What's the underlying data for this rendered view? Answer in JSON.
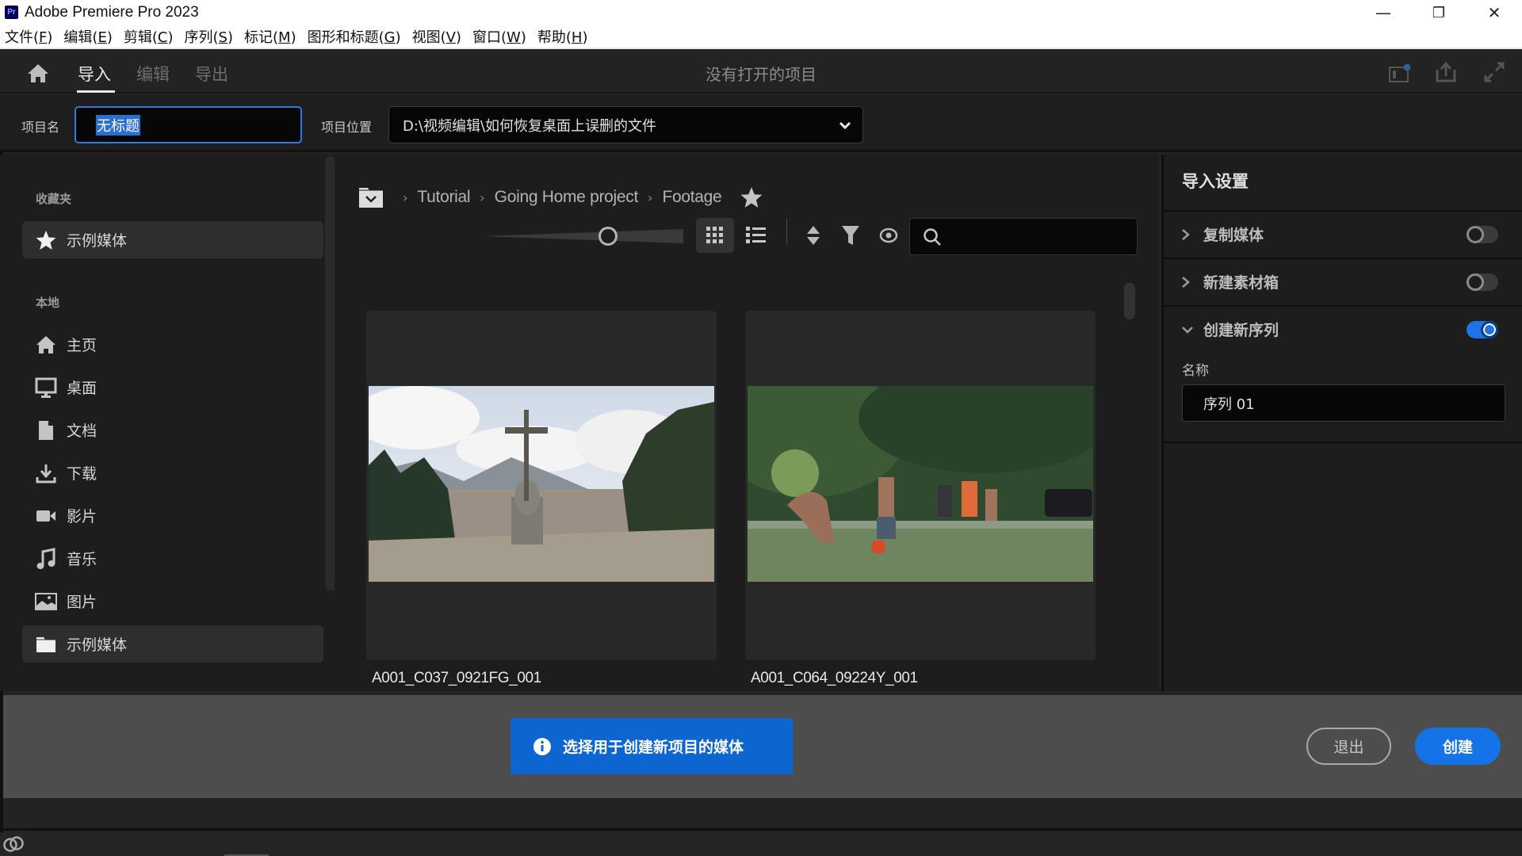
{
  "window": {
    "app_badge": "Pr",
    "title": "Adobe Premiere Pro 2023",
    "controls": {
      "minimize": "—",
      "restore": "❐",
      "close": "✕"
    }
  },
  "menu": [
    {
      "label": "文件(",
      "key": "F",
      "end": ")"
    },
    {
      "label": "编辑(",
      "key": "E",
      "end": ")"
    },
    {
      "label": "剪辑(",
      "key": "C",
      "end": ")"
    },
    {
      "label": "序列(",
      "key": "S",
      "end": ")"
    },
    {
      "label": "标记(",
      "key": "M",
      "end": ")"
    },
    {
      "label": "图形和标题(",
      "key": "G",
      "end": ")"
    },
    {
      "label": "视图(",
      "key": "V",
      "end": ")"
    },
    {
      "label": "窗口(",
      "key": "W",
      "end": ")"
    },
    {
      "label": "帮助(",
      "key": "H",
      "end": ")"
    }
  ],
  "topbar": {
    "tabs": [
      {
        "label": "导入",
        "active": true
      },
      {
        "label": "编辑",
        "active": false
      },
      {
        "label": "导出",
        "active": false
      }
    ],
    "center_title": "没有打开的项目",
    "right_icons": [
      "quick-export-icon",
      "share-icon",
      "fullscreen-icon"
    ]
  },
  "project": {
    "name_label": "项目名",
    "name_value": "无标题",
    "location_label": "项目位置",
    "location_value": "D:\\视频编辑\\如何恢复桌面上误删的文件"
  },
  "sidebar": {
    "favorites_heading": "收藏夹",
    "favorites": [
      {
        "label": "示例媒体",
        "icon": "star-icon",
        "selected": true
      }
    ],
    "local_heading": "本地",
    "local": [
      {
        "label": "主页",
        "icon": "home-icon"
      },
      {
        "label": "桌面",
        "icon": "desktop-icon"
      },
      {
        "label": "文档",
        "icon": "document-icon"
      },
      {
        "label": "下载",
        "icon": "download-icon"
      },
      {
        "label": "影片",
        "icon": "video-icon"
      },
      {
        "label": "音乐",
        "icon": "music-icon"
      },
      {
        "label": "图片",
        "icon": "image-icon"
      },
      {
        "label": "示例媒体",
        "icon": "folder-icon",
        "selected": true
      }
    ]
  },
  "browser": {
    "breadcrumb": [
      "Tutorial",
      "Going Home project",
      "Footage"
    ],
    "search_placeholder": "",
    "view_mode": "grid",
    "thumbnail_size": 0.64,
    "items": [
      {
        "name": "A001_C037_0921FG_001",
        "thumb": "cross-overlooking-city"
      },
      {
        "name": "A001_C064_09224Y_001",
        "thumb": "kids-playing-soccer"
      }
    ]
  },
  "import_settings": {
    "title": "导入设置",
    "rows": [
      {
        "label": "复制媒体",
        "expanded": false,
        "enabled": false
      },
      {
        "label": "新建素材箱",
        "expanded": false,
        "enabled": false
      },
      {
        "label": "创建新序列",
        "expanded": true,
        "enabled": true
      }
    ],
    "name_label": "名称",
    "sequence_name": "序列 01"
  },
  "footer": {
    "info_message": "选择用于创建新项目的媒体",
    "quit_label": "退出",
    "create_label": "创建"
  },
  "colors": {
    "accent": "#1473e6",
    "toast": "#0d66d0",
    "selection": "#2a6fd0"
  }
}
